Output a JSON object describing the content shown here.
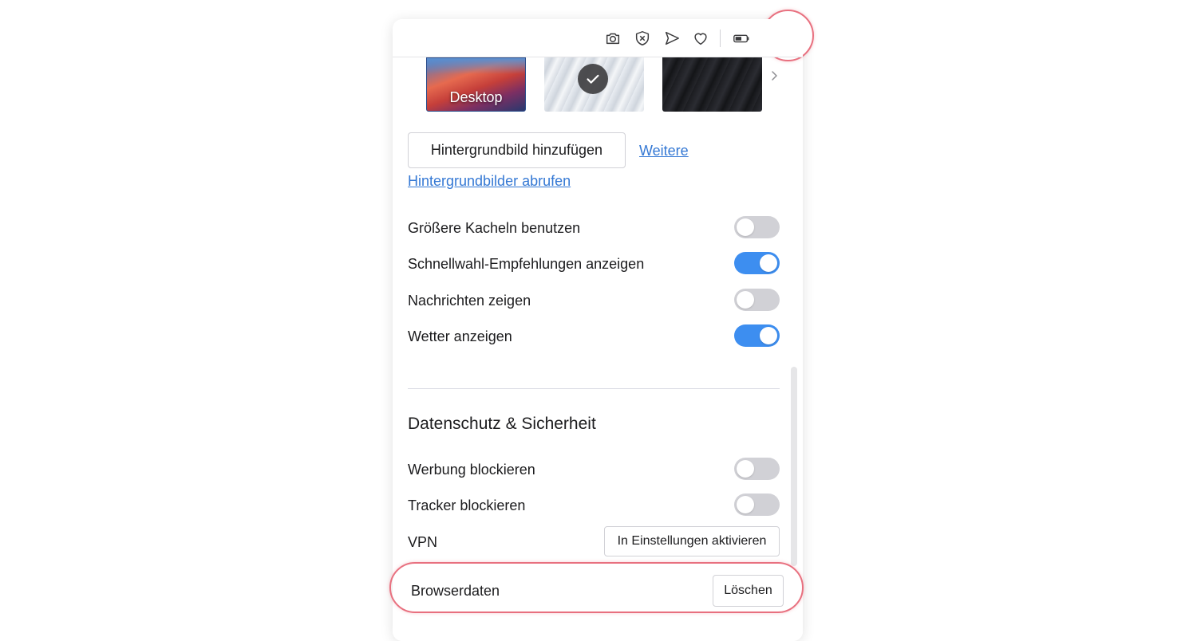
{
  "colors": {
    "accent": "#3d8ef0",
    "link": "#3478d4",
    "highlight": "#e8707f",
    "toggle_off": "#d1d1d6"
  },
  "toolbar": {
    "icons": [
      "camera-icon",
      "shield-block-icon",
      "send-icon",
      "heart-icon",
      "battery-icon",
      "settings-sliders-icon"
    ]
  },
  "wallpapers": {
    "items": [
      {
        "label": "Desktop",
        "selected": false
      },
      {
        "label": "",
        "selected": true
      },
      {
        "label": "",
        "selected": false
      }
    ]
  },
  "appearance": {
    "add_wallpaper_button": "Hintergrundbild hinzufügen",
    "more_link": "Weitere",
    "fetch_link": "Hintergrundbilder abrufen",
    "toggles": [
      {
        "label": "Größere Kacheln benutzen",
        "on": false
      },
      {
        "label": "Schnellwahl-Empfehlungen anzeigen",
        "on": true
      },
      {
        "label": "Nachrichten zeigen",
        "on": false
      },
      {
        "label": "Wetter anzeigen",
        "on": true
      }
    ]
  },
  "privacy": {
    "title": "Datenschutz & Sicherheit",
    "toggles": [
      {
        "label": "Werbung blockieren",
        "on": false
      },
      {
        "label": "Tracker blockieren",
        "on": false
      }
    ],
    "vpn_label": "VPN",
    "vpn_button": "In Einstellungen aktivieren",
    "browserdata_label": "Browserdaten",
    "clear_button": "Löschen"
  }
}
